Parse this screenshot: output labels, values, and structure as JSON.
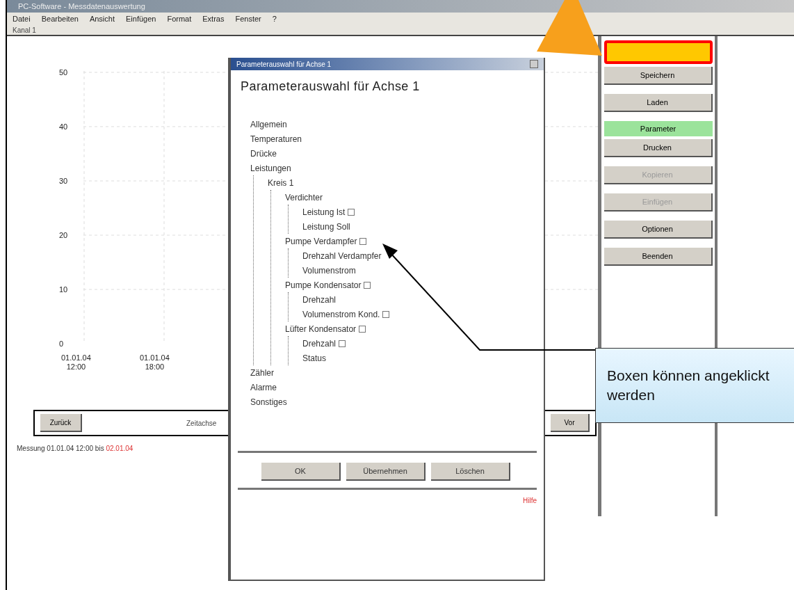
{
  "window": {
    "title": "PC-Software - Messdatenauswertung"
  },
  "menu": [
    "Datei",
    "Bearbeiten",
    "Ansicht",
    "Einfügen",
    "Format",
    "Extras",
    "Fenster",
    "?"
  ],
  "toolbar_label": "Kanal 1",
  "chart": {
    "yticks": [
      "50",
      "40",
      "30",
      "20",
      "10",
      "0"
    ],
    "xticks": [
      [
        "01.01.04",
        "12:00"
      ],
      [
        "01.01.04",
        "18:00"
      ]
    ]
  },
  "side_buttons": [
    {
      "kind": "highlight"
    },
    {
      "label": "Speichern",
      "kind": "normal"
    },
    {
      "label": "Laden",
      "kind": "normal"
    },
    {
      "label": "Parameter",
      "kind": "active"
    },
    {
      "label": "Drucken",
      "kind": "normal"
    },
    {
      "label": "Kopieren",
      "kind": "disabled"
    },
    {
      "label": "Einfügen",
      "kind": "disabled"
    },
    {
      "label": "Optionen",
      "kind": "normal"
    },
    {
      "label": "Beenden",
      "kind": "normal"
    }
  ],
  "bottom_bar": {
    "left_button": "Zurück",
    "label": "Zeitachse",
    "right_button": "Vor"
  },
  "status": {
    "text": "Messung 01.01.04 12:00 bis ",
    "highlight": "02.01.04"
  },
  "dialog": {
    "title": "Parameterauswahl für Achse 1",
    "heading": "Parameterauswahl für Achse 1",
    "tree": [
      {
        "label": "Allgemein"
      },
      {
        "label": "Temperaturen"
      },
      {
        "label": "Drücke"
      },
      {
        "label": "Leistungen",
        "children": [
          {
            "label": "Kreis 1",
            "children": [
              {
                "label": "Verdichter",
                "children": [
                  {
                    "label": "Leistung Ist",
                    "checked": false
                  },
                  {
                    "label": "Leistung Soll"
                  }
                ]
              },
              {
                "label": "Pumpe Verdampfer",
                "checked": false,
                "children": [
                  {
                    "label": "Drehzahl Verdampfer"
                  },
                  {
                    "label": "Volumenstrom"
                  }
                ]
              },
              {
                "label": "Pumpe Kondensator",
                "checked": false,
                "children": [
                  {
                    "label": "Drehzahl"
                  },
                  {
                    "label": "Volumenstrom Kond.",
                    "checked": false
                  }
                ]
              },
              {
                "label": "Lüfter Kondensator",
                "checked": false,
                "children": [
                  {
                    "label": "Drehzahl",
                    "checked": false
                  },
                  {
                    "label": "Status"
                  }
                ]
              }
            ]
          }
        ]
      },
      {
        "label": "Zähler"
      },
      {
        "label": "Alarme"
      },
      {
        "label": "Sonstiges"
      }
    ],
    "buttons": [
      "OK",
      "Übernehmen",
      "Löschen"
    ],
    "footer": "Hilfe"
  },
  "callout": {
    "text": "Boxen können angeklickt werden"
  }
}
